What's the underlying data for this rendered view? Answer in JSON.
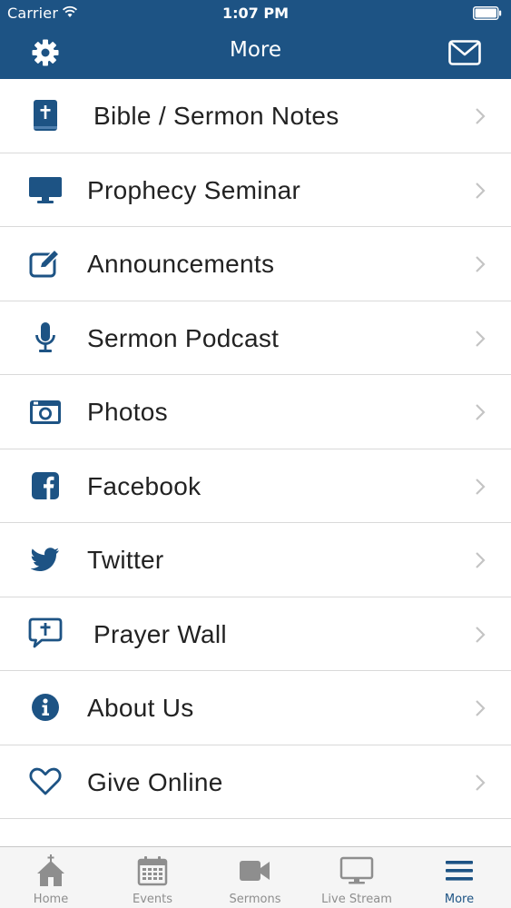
{
  "status_bar": {
    "carrier": "Carrier",
    "time": "1:07 PM"
  },
  "nav": {
    "title": "More",
    "left_icon": "gear-icon",
    "right_icon": "envelope-icon"
  },
  "menu": {
    "items": [
      {
        "label": "Bible / Sermon Notes",
        "icon": "bible-icon"
      },
      {
        "label": "Prophecy Seminar",
        "icon": "monitor-icon"
      },
      {
        "label": "Announcements",
        "icon": "edit-icon"
      },
      {
        "label": "Sermon Podcast",
        "icon": "microphone-icon"
      },
      {
        "label": "Photos",
        "icon": "camera-icon"
      },
      {
        "label": "Facebook",
        "icon": "facebook-icon"
      },
      {
        "label": "Twitter",
        "icon": "twitter-icon"
      },
      {
        "label": "Prayer Wall",
        "icon": "prayer-bubble-icon"
      },
      {
        "label": "About Us",
        "icon": "info-icon"
      },
      {
        "label": "Give Online",
        "icon": "heart-icon"
      }
    ]
  },
  "tab_bar": {
    "tabs": [
      {
        "label": "Home",
        "icon": "church-icon",
        "active": false
      },
      {
        "label": "Events",
        "icon": "calendar-icon",
        "active": false
      },
      {
        "label": "Sermons",
        "icon": "video-camera-icon",
        "active": false
      },
      {
        "label": "Live Stream",
        "icon": "monitor-icon",
        "active": false
      },
      {
        "label": "More",
        "icon": "menu-icon",
        "active": true
      }
    ]
  },
  "colors": {
    "brand": "#1d5384",
    "tab_inactive": "#8e8e8e",
    "text": "#222222",
    "separator": "#d9d9d9",
    "chevron": "#c4c4c4"
  }
}
